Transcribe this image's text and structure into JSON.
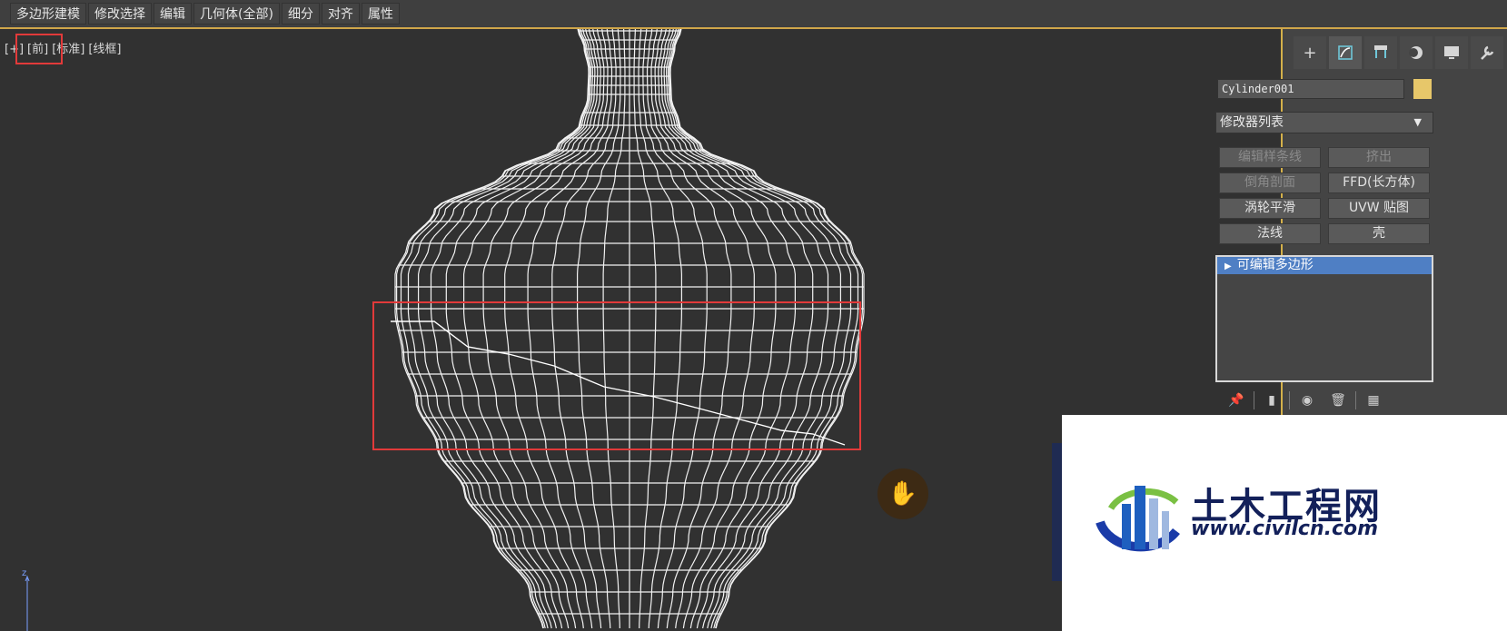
{
  "menubar": {
    "items": [
      "多边形建模",
      "修改选择",
      "编辑",
      "几何体(全部)",
      "细分",
      "对齐",
      "属性"
    ]
  },
  "viewport": {
    "label_plus": "[+]",
    "label_view": "[前]",
    "label_shading": "[标准]",
    "label_mode": "[线框]",
    "axis_label": "z"
  },
  "command_panel": {
    "tab_icons": [
      "create-icon",
      "modify-icon",
      "hierarchy-icon",
      "motion-icon",
      "display-icon",
      "utilities-icon"
    ],
    "object_name": "Cylinder001",
    "object_color": "#e7c76a",
    "modifier_list_label": "修改器列表",
    "modifier_buttons": [
      {
        "label": "编辑样条线",
        "enabled": false
      },
      {
        "label": "挤出",
        "enabled": false
      },
      {
        "label": "倒角剖面",
        "enabled": false
      },
      {
        "label": "FFD(长方体)",
        "enabled": true
      },
      {
        "label": "涡轮平滑",
        "enabled": true
      },
      {
        "label": "UVW 贴图",
        "enabled": true
      },
      {
        "label": "法线",
        "enabled": true
      },
      {
        "label": "壳",
        "enabled": true
      }
    ],
    "stack_items": [
      "可编辑多边形"
    ],
    "stack_tool_icons": [
      "pin-stack-icon",
      "show-end-result-icon",
      "make-unique-icon",
      "remove-modifier-icon",
      "configure-modifier-sets-icon"
    ]
  },
  "watermark": {
    "title": "土木工程网",
    "url": "www.civilcn.com"
  },
  "colors": {
    "accent": "#d4b04a",
    "highlight": "#e23a3a",
    "selection": "#4f7fc4"
  }
}
